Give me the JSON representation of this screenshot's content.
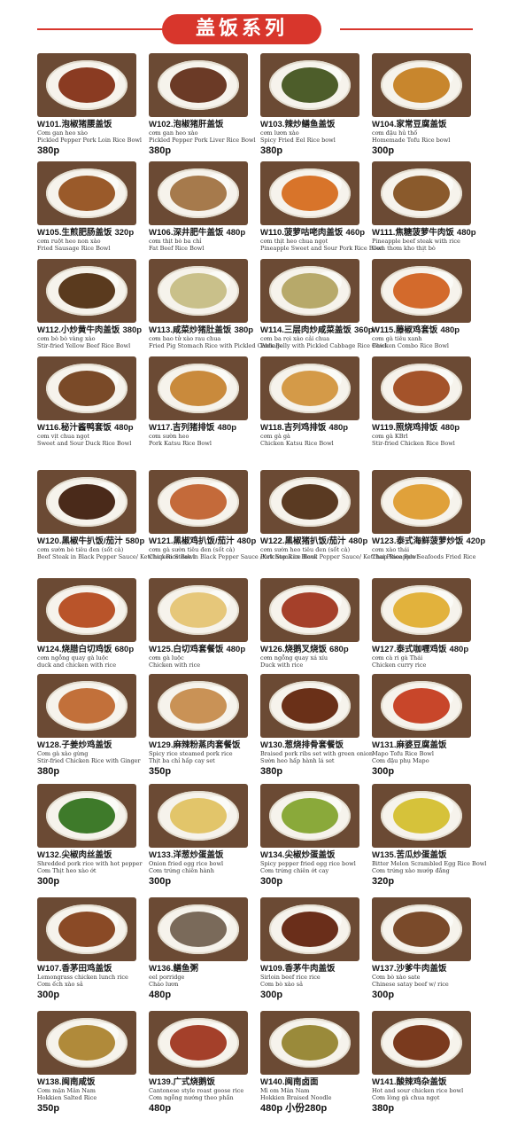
{
  "header": {
    "title": "盖饭系列"
  },
  "colors": {
    "accent": "#d8362c"
  },
  "menu": [
    {
      "code": "W101.泡椒猪腰盖饭",
      "inline_price": "",
      "viet": "Cơm gan heo xào",
      "eng": "Pickled Pepper Pork Loin Rice Bowl",
      "price": "380p",
      "col": 0,
      "row": 0,
      "food": "#8a3b22"
    },
    {
      "code": "W102.泡椒猪肝盖饭",
      "inline_price": "",
      "viet": "cơm gan heo xào",
      "eng": "Pickled Pepper Pork Liver Rice Bowl",
      "price": "380p",
      "col": 1,
      "row": 0,
      "food": "#6b3a26"
    },
    {
      "code": "W103.辣炒鳝鱼盖饭",
      "inline_price": "",
      "viet": "cơm lươn xào",
      "eng": "Spicy Fried Eel Rice bowl",
      "price": "380p",
      "col": 2,
      "row": 0,
      "food": "#4d5d2a"
    },
    {
      "code": "W104.家常豆腐盖饭",
      "inline_price": "",
      "viet": "cơm đậu hủ thố",
      "eng": "Homemade Tofu Rice bowl",
      "price": "300p",
      "col": 3,
      "row": 0,
      "food": "#c8862d"
    },
    {
      "code": "W105.生煎肥肠盖饭",
      "inline_price": "320p",
      "viet": "cơm ruột heo non xào",
      "eng": "Fried Sausage Rice Bowl",
      "price": "",
      "col": 0,
      "row": 1,
      "food": "#9a5a2a"
    },
    {
      "code": "W106.深井肥牛盖饭",
      "inline_price": "480p",
      "viet": "cơm thịt bò ba chỉ",
      "eng": "Fat Beef Rice Bowl",
      "price": "",
      "col": 1,
      "row": 1,
      "food": "#a67a4c"
    },
    {
      "code": "W110.菠萝咕咾肉盖饭",
      "inline_price": "460p",
      "viet": "cơm thịt heo chua ngọt",
      "eng": "Pineapple Sweet and Sour Pork Rice Bowl",
      "price": "",
      "col": 2,
      "row": 1,
      "food": "#d8742a"
    },
    {
      "code": "W111.焦糖菠萝牛肉饭",
      "inline_price": "480p",
      "viet": "Pineapple beef steak with rice",
      "eng": "Cơm thơm kho thịt bò",
      "price": "",
      "col": 3,
      "row": 1,
      "food": "#8a5a2c"
    },
    {
      "code": "W112.小炒黄牛肉盖饭",
      "inline_price": "380p",
      "viet": "cơm bò bò vàng xào",
      "eng": "Stir-fried Yellow Beef Rice Bowl",
      "price": "",
      "col": 0,
      "row": 2,
      "food": "#5a3a1e"
    },
    {
      "code": "W113.咸菜炒猪肚盖饭",
      "inline_price": "380p",
      "viet": "cơm bao tử xào rau chua",
      "eng": "Fried Pig Stomach Rice with Pickled Cabbage",
      "price": "",
      "col": 1,
      "row": 2,
      "food": "#c9c08a"
    },
    {
      "code": "W114.三层肉炒咸菜盖饭",
      "inline_price": "360p",
      "viet": "cơm ba rọi xào cải chua",
      "eng": "Pork Belly with Pickled Cabbage Rice Bowl",
      "price": "",
      "col": 2,
      "row": 2,
      "food": "#b7a96a"
    },
    {
      "code": "W115.藤椒鸡套饭",
      "inline_price": "480p",
      "viet": "cơm gà tiêu xanh",
      "eng": "Chicken Combo Rice Bowl",
      "price": "",
      "col": 3,
      "row": 2,
      "food": "#d36a2c"
    },
    {
      "code": "W116.秘汁酱鸭套饭",
      "inline_price": "480p",
      "viet": "cơm vịt chua ngọt",
      "eng": "Sweet and Sour Duck Rice Bowl",
      "price": "",
      "col": 0,
      "row": 3,
      "food": "#7a4a28"
    },
    {
      "code": "W117.吉列猪排饭",
      "inline_price": "480p",
      "viet": "cơm sườn heo",
      "eng": "Pork Katsu Rice Bowl",
      "price": "",
      "col": 1,
      "row": 3,
      "food": "#c98a3c"
    },
    {
      "code": "W118.吉列鸡排饭",
      "inline_price": "480p",
      "viet": "cơm gà gà",
      "eng": "Chicken Katsu Rice Bowl",
      "price": "",
      "col": 2,
      "row": 3,
      "food": "#d49a48"
    },
    {
      "code": "W119.照烧鸡排饭",
      "inline_price": "480p",
      "viet": "cơm gà KBrl",
      "eng": "Stir-fried Chicken Rice Bowl",
      "price": "",
      "col": 3,
      "row": 3,
      "food": "#a4532a"
    },
    {
      "code": "W120.黑椒牛扒饭/茄汁",
      "inline_price": "580p",
      "viet": "cơm sườn bò tiêu đen (sốt cà)",
      "eng": "Beef Steak in Black Pepper Sauce/ Ketchup Rice Bowl",
      "price": "",
      "col": 0,
      "row": 4,
      "food": "#4a2a1a"
    },
    {
      "code": "W121.黑椒鸡扒饭/茄汁",
      "inline_price": "480p",
      "viet": "cơm gà sườn tiêu đen (sốt cà)",
      "eng": "Chicken Steak in Black Pepper Sauce /Ketchup Rice Bowl",
      "price": "",
      "col": 1,
      "row": 4,
      "food": "#c46a3a"
    },
    {
      "code": "W122.黑椒猪扒饭/茄汁",
      "inline_price": "480p",
      "viet": "cơm sườn heo tiêu đen (sốt cà)",
      "eng": "Pork Steak in Black Pepper Sauce/ Ketchup Rice Bowl",
      "price": "",
      "col": 2,
      "row": 4,
      "food": "#5a3a22"
    },
    {
      "code": "W123.泰式海鲜菠萝炒饭",
      "inline_price": "420p",
      "viet": "cơm xào thái",
      "eng": "Thai Pineapple Seafoods Fried Rice",
      "price": "",
      "col": 3,
      "row": 4,
      "food": "#e0a13a"
    },
    {
      "code": "W124.烧腊白切鸡饭",
      "inline_price": "680p",
      "viet": "cơm ngỗng quay gà luộc",
      "eng": "duck and chicken with rice",
      "price": "",
      "col": 0,
      "row": 5,
      "food": "#b9542a"
    },
    {
      "code": "W125.白切鸡套餐饭",
      "inline_price": "480p",
      "viet": "cơm gà luộc",
      "eng": "Chicken with rice",
      "price": "",
      "col": 1,
      "row": 5,
      "food": "#e6c77a"
    },
    {
      "code": "W126.烧鹅叉烧饭",
      "inline_price": "680p",
      "viet": "cơm ngỗng quay xá xíu",
      "eng": "Duck with rice",
      "price": "",
      "col": 2,
      "row": 5,
      "food": "#a5402a"
    },
    {
      "code": "W127.泰式咖喱鸡饭",
      "inline_price": "480p",
      "viet": "cơm cà ri gà Thái",
      "eng": "Chicken curry rice",
      "price": "",
      "col": 3,
      "row": 5,
      "food": "#e2b23c"
    },
    {
      "code": "W128.子姜炒鸡盖饭",
      "inline_price": "",
      "viet": "Cơm gà xào gừng",
      "eng": "Stir-fried Chicken Rice with Ginger",
      "price": "380p",
      "col": 0,
      "row": 6,
      "food": "#c2703a"
    },
    {
      "code": "W129.麻辣粉蒸肉套餐饭",
      "inline_price": "",
      "viet": "Spicy rice steamed pork rice",
      "eng": "Thịt ba chỉ hấp cay set",
      "price": "350p",
      "col": 1,
      "row": 6,
      "food": "#c99256"
    },
    {
      "code": "W130.葱烧排骨套餐饭",
      "inline_price": "",
      "viet": "Braised pork ribs set with green onion",
      "eng": "Sườn heo hấp hành lá set",
      "price": "380p",
      "col": 2,
      "row": 6,
      "food": "#6a3018"
    },
    {
      "code": "W131.麻婆豆腐盖饭",
      "inline_price": "",
      "viet": "Mapo Tofu Rice Bowl",
      "eng": "Cơm đậu phụ Mapo",
      "price": "300p",
      "col": 3,
      "row": 6,
      "food": "#c8462a"
    },
    {
      "code": "W132.尖椒肉丝盖饭",
      "inline_price": "",
      "viet": "Shredded pork rice with hot pepper",
      "eng": "Cơm Thịt heo xào ớt",
      "price": "300p",
      "col": 0,
      "row": 7,
      "food": "#3e7a2a"
    },
    {
      "code": "W133.洋葱炒蛋盖饭",
      "inline_price": "",
      "viet": "Onion fried egg rice bowl",
      "eng": "Cơm trứng chiên hành",
      "price": "300p",
      "col": 1,
      "row": 7,
      "food": "#e2c56a"
    },
    {
      "code": "W134.尖椒炒蛋盖饭",
      "inline_price": "",
      "viet": "Spicy pepper fried egg rice bowl",
      "eng": "Cơm trứng chiên ớt cay",
      "price": "300p",
      "col": 2,
      "row": 7,
      "food": "#8aa93a"
    },
    {
      "code": "W135.苦瓜炒蛋盖饭",
      "inline_price": "",
      "viet": "Bitter Melon Scrambled Egg Rice Bowl",
      "eng": "Cơm trứng xào mướp đắng",
      "price": "320p",
      "col": 3,
      "row": 7,
      "food": "#d6c23a"
    },
    {
      "code": "W107.香茅田鸡盖饭",
      "inline_price": "",
      "viet": "Lemongrass chicken lunch rice",
      "eng": "Cơm ếch xào sả",
      "price": "300p",
      "col": 0,
      "row": 8,
      "food": "#8a4a26"
    },
    {
      "code": "W136.鳝鱼粥",
      "inline_price": "",
      "viet": "eel porridge",
      "eng": "Cháo lươn",
      "price": "480p",
      "col": 1,
      "row": 8,
      "food": "#7a6a5a"
    },
    {
      "code": "W109.香茅牛肉盖饭",
      "inline_price": "",
      "viet": "Sirloin beef rice rice",
      "eng": "Cơm bò xào sả",
      "price": "300p",
      "col": 2,
      "row": 8,
      "food": "#6a2e1a"
    },
    {
      "code": "W137.沙爹牛肉盖饭",
      "inline_price": "",
      "viet": "Cơm bò xào sate",
      "eng": "Chinese satay beef w/ rice",
      "price": "300p",
      "col": 3,
      "row": 8,
      "food": "#7a4a2a"
    },
    {
      "code": "W138.闽南咸饭",
      "inline_price": "",
      "viet": "Cơm mặn Mân Nam",
      "eng": "Hokkien Salted Rice",
      "price": "350p",
      "col": 0,
      "row": 9,
      "food": "#b08a3a"
    },
    {
      "code": "W139.广式烧鹅饭",
      "inline_price": "",
      "viet": "Cantonese style roast goose rice",
      "eng": "Cơm ngỗng nướng theo phần",
      "price": "480p",
      "col": 1,
      "row": 9,
      "food": "#a4402a"
    },
    {
      "code": "W140.闽南卤面",
      "inline_price": "",
      "viet": "Mì om Mân Nam",
      "eng": "Hokkien Braised Noodle",
      "price": "480p 小份280p",
      "col": 2,
      "row": 9,
      "food": "#9a8a3a"
    },
    {
      "code": "W141.酸辣鸡杂盖饭",
      "inline_price": "",
      "viet": "Hot and sour chicken rice bowl",
      "eng": "Cơm lòng gà chua ngọt",
      "price": "380p",
      "col": 3,
      "row": 9,
      "food": "#7a3a1e"
    }
  ]
}
